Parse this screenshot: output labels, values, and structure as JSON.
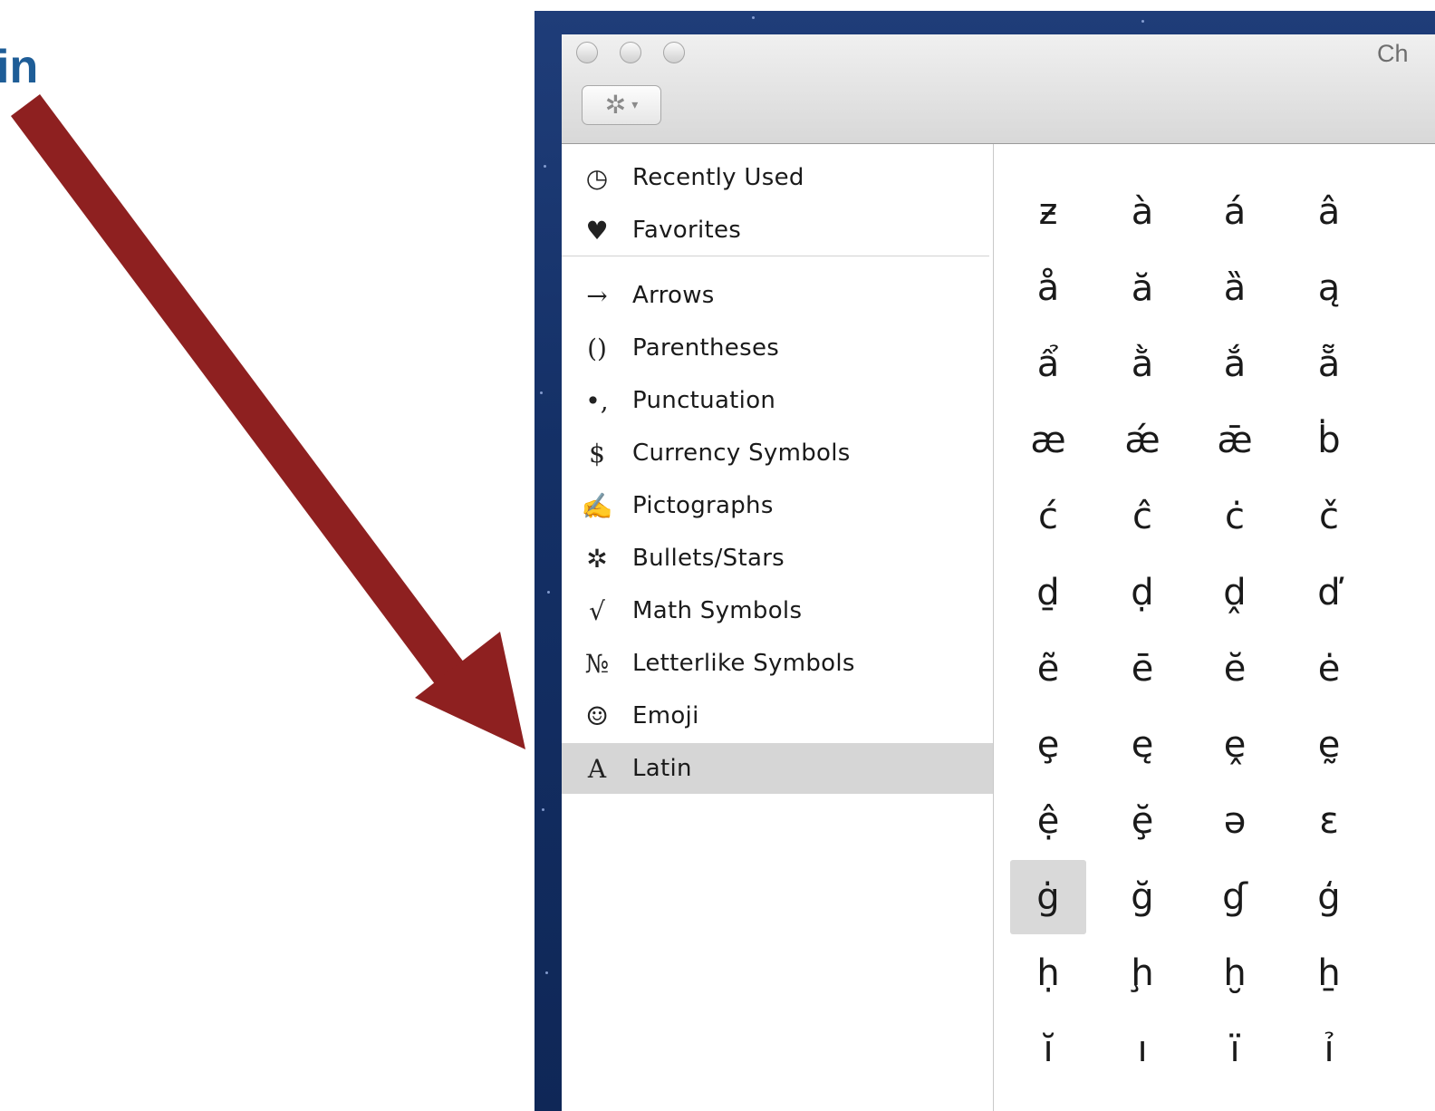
{
  "callout": {
    "text": "in"
  },
  "window": {
    "title_fragment": "Ch",
    "gear_menu_label": "✲",
    "gear_caret": "▾"
  },
  "sidebar": {
    "items": [
      {
        "label": "Recently Used",
        "glyph": "◷",
        "icon": "clock-icon"
      },
      {
        "label": "Favorites",
        "glyph": "♥",
        "icon": "heart-icon"
      },
      {
        "label": "Arrows",
        "glyph": "→",
        "icon": "arrow-icon"
      },
      {
        "label": "Parentheses",
        "glyph": "()",
        "icon": "parentheses-icon"
      },
      {
        "label": "Punctuation",
        "glyph": "•,",
        "icon": "punctuation-icon"
      },
      {
        "label": "Currency Symbols",
        "glyph": "$",
        "icon": "dollar-icon"
      },
      {
        "label": "Pictographs",
        "glyph": "✍",
        "icon": "pictograph-icon"
      },
      {
        "label": "Bullets/Stars",
        "glyph": "✲",
        "icon": "asterisk-icon"
      },
      {
        "label": "Math Symbols",
        "glyph": "√",
        "icon": "square-root-icon"
      },
      {
        "label": "Letterlike Symbols",
        "glyph": "№",
        "icon": "numero-icon"
      },
      {
        "label": "Emoji",
        "glyph": "☺",
        "icon": "smiley-icon"
      },
      {
        "label": "Latin",
        "glyph": "A",
        "icon": "letter-a-icon",
        "selected": true
      }
    ]
  },
  "characters": {
    "rows": [
      [
        "ƶ",
        "à",
        "á",
        "â"
      ],
      [
        "å",
        "ă",
        "ȁ",
        "ą"
      ],
      [
        "ẩ",
        "ằ",
        "ắ",
        "ẵ"
      ],
      [
        "æ",
        "ǽ",
        "ǣ",
        "ḃ"
      ],
      [
        "ć",
        "ĉ",
        "ċ",
        "č"
      ],
      [
        "ḏ",
        "ḍ",
        "ḓ",
        "ď"
      ],
      [
        "ẽ",
        "ē",
        "ĕ",
        "ė"
      ],
      [
        "ȩ",
        "ę",
        "ḙ",
        "ḛ"
      ],
      [
        "ệ",
        "ḝ",
        "ə",
        "ɛ"
      ],
      [
        "ġ",
        "ğ",
        "ɠ",
        "ģ"
      ],
      [
        "ḥ",
        "ḩ",
        "ḫ",
        "ẖ"
      ],
      [
        "ĭ",
        "ı",
        "ï",
        "ỉ"
      ]
    ],
    "selected_char": "ġ"
  },
  "colors": {
    "arrow": "#8e2020",
    "callout": "#1e5d97",
    "desktop": "#1a3a75"
  }
}
